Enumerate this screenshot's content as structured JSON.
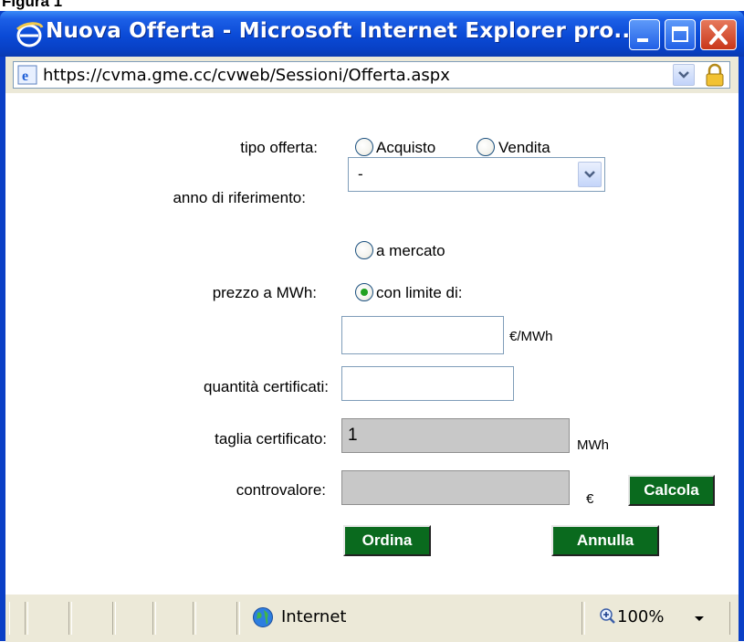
{
  "figure_label": "Figura 1",
  "window": {
    "title": "Nuova Offerta - Microsoft Internet Explorer pro...",
    "address": "https://cvma.gme.cc/cvweb/Sessioni/Offerta.aspx",
    "title_icon": "ie-icon",
    "address_icon": "ie-page-icon",
    "lock_icon": "padlock-icon",
    "colors": {
      "titlebar": "#0a4ad6",
      "button_green": "#0a6a1e",
      "readonly_bg": "#c8c8c8"
    }
  },
  "form": {
    "tipo_offerta_label": "tipo offerta:",
    "tipo_options": [
      "Acquisto",
      "Vendita"
    ],
    "tipo_selected": null,
    "anno_label": "anno di riferimento:",
    "anno_value": "-",
    "prezzo_label": "prezzo a MWh:",
    "prezzo_options": [
      "a mercato",
      "con limite di:"
    ],
    "prezzo_selected": "con limite di:",
    "prezzo_value": "",
    "prezzo_unit": "€/MWh",
    "quantita_label": "quantità certificati:",
    "quantita_value": "",
    "taglia_label": "taglia certificato:",
    "taglia_value": "1",
    "taglia_unit": "MWh",
    "controvalore_label": "controvalore:",
    "controvalore_value": "",
    "controvalore_unit": "€",
    "calcola_label": "Calcola",
    "ordina_label": "Ordina",
    "annulla_label": "Annulla"
  },
  "statusbar": {
    "zone": "Internet",
    "zone_icon": "globe-icon",
    "zoom": "100%",
    "zoom_icon": "zoom-icon"
  }
}
